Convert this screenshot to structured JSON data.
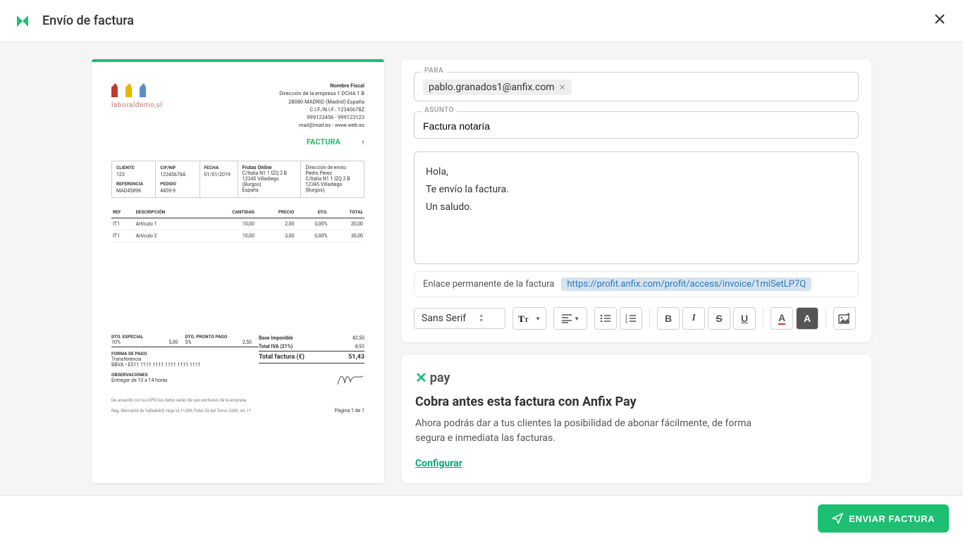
{
  "header": {
    "title": "Envío de factura"
  },
  "preview": {
    "company_name": "laboraldemo,sl",
    "fiscal": {
      "name": "Nombre Fiscal",
      "addr1": "Dirección de la empresa 1 DCHA 1 B",
      "addr2": "28080 MADRID (Madrid) España",
      "cif": "C.I.F./N.I.F.: 12345678Z",
      "phone": "999123456 - 999123123",
      "mail": "mail@mail.es - www.web.es"
    },
    "factura_label": "FACTURA",
    "factura_num": "1",
    "boxes": {
      "cliente_label": "CLIENTE",
      "cliente": "123",
      "ref_label": "REFERENCIA",
      "ref": "MAD45896",
      "cif_label": "CIF/NIF",
      "cif": "12345678A",
      "pedido_label": "PEDIDO",
      "pedido": "4459-9",
      "fecha_label": "FECHA",
      "fecha": "01/01/2019",
      "company_name": "Frutas Online",
      "company_addr1": "C/Italia N1 1 IZQ 2 B",
      "company_addr2": "12345 Villadiego (Burgos)",
      "company_addr3": "España",
      "envio_label": "Dirección de envío:",
      "envio_name": "Pedro Pérez",
      "envio_addr1": "C/Italia N1 1 IZQ 2 B",
      "envio_addr2": "12345 Villadiego (Burgos)"
    },
    "cols": {
      "ref": "REF",
      "desc": "DESCRIPCIÓN",
      "qty": "CANTIDAD",
      "price": "PRECIO",
      "dto": "DTO.",
      "total": "TOTAL"
    },
    "lines": [
      {
        "ref": "IT1",
        "desc": "Artículo 1",
        "qty": "10,00",
        "price": "2,00",
        "dto": "0,00%",
        "total": "20,00"
      },
      {
        "ref": "IT1",
        "desc": "Artículo 2",
        "qty": "10,00",
        "price": "3,00",
        "dto": "0,00%",
        "total": "30,00"
      }
    ],
    "totals": {
      "dto_esp_label": "DTO. ESPECIAL",
      "dto_esp_pct": "10%",
      "dto_esp_val": "5,00",
      "dto_pp_label": "DTO. PRONTO PAGO",
      "dto_pp_pct": "5%",
      "dto_pp_val": "2,50",
      "forma_label": "FORMA DE PAGO",
      "forma": "Transferencia",
      "iban": "BBVA • ES11 1111 1111 1111 1111 1111",
      "obs_label": "OBSERVACIONES",
      "obs": "Entregar de 10 a 14 horas",
      "base_label": "Base Imponible",
      "base": "42,50",
      "iva_label": "Total IVA (21%)",
      "iva": "8,93",
      "total_label": "Total factura (€)",
      "total": "51,43"
    },
    "legal1": "De acuerdo con la LOPD los datos serán de uso exclusivo de la empresa.",
    "legal2": "Reg. Mercantil de Valladolid, Hoja VL11289, Folio 23 del Tomo 3289, inc 1ª",
    "page": "Página 1 de 1"
  },
  "form": {
    "para_label": "PARA",
    "recipient": "pablo.granados1@anfix.com",
    "asunto_label": "ASUNTO",
    "subject": "Factura notaría",
    "body_line1": "Hola,",
    "body_line2": "Te envío la factura.",
    "body_line3": "Un saludo.",
    "permalink_label": "Enlace permanente de la factura",
    "permalink_url": "https://profit.anfix.com/profit/access/invoice/1miSetLP7Q",
    "font_name": "Sans Serif"
  },
  "pay": {
    "logo_text": "pay",
    "title": "Cobra antes esta factura con Anfix Pay",
    "desc": "Ahora podrás dar a tus clientes la posibilidad de abonar fácilmente, de forma segura e inmediata las facturas.",
    "configure": "Configurar"
  },
  "footer": {
    "send": "ENVIAR FACTURA"
  }
}
